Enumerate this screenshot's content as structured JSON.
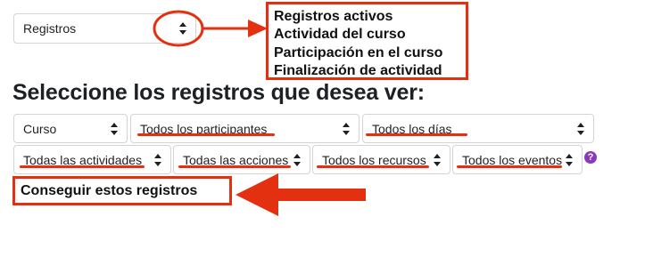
{
  "top_select": {
    "value": "Registros"
  },
  "log_type_options": [
    "Registros activos",
    "Actividad del curso",
    "Participación en el curso",
    "Finalización de actividad"
  ],
  "heading": "Seleccione los registros que desea ver:",
  "filters_row1": {
    "course": "Curso",
    "participants": "Todos los participantes",
    "days": "Todos los días"
  },
  "filters_row2": {
    "activities": "Todas las actividades",
    "actions": "Todas las acciones",
    "resources": "Todos los recursos",
    "events": "Todos los eventos"
  },
  "help_icon": {
    "glyph": "?",
    "color": "#8a3ab9"
  },
  "submit_button": "Conseguir estos registros",
  "annotation_color": "#e23010"
}
